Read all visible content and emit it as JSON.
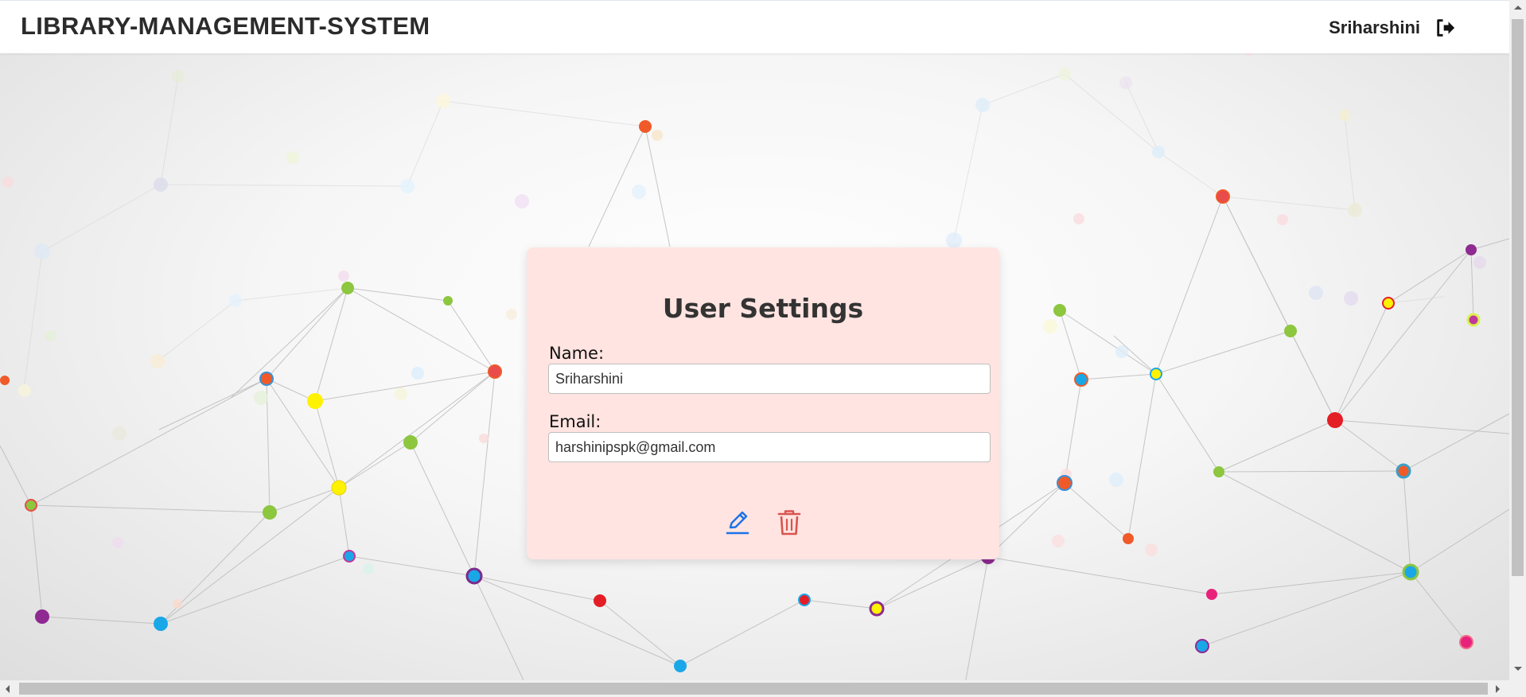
{
  "app": {
    "title": "LIBRARY-MANAGEMENT-SYSTEM"
  },
  "nav": {
    "username": "Sriharshini",
    "logout_icon": "logout-icon"
  },
  "settings": {
    "title": "User Settings",
    "name_label": "Name:",
    "name_value": "Sriharshini",
    "email_label": "Email:",
    "email_value": "harshinipspk@gmail.com",
    "edit_icon": "pencil-icon",
    "delete_icon": "trash-icon"
  },
  "colors": {
    "card_bg": "#ffe4e1",
    "edit_icon": "#1a73e8",
    "delete_icon": "#d9534f",
    "brand_text": "#2b2b2b"
  }
}
